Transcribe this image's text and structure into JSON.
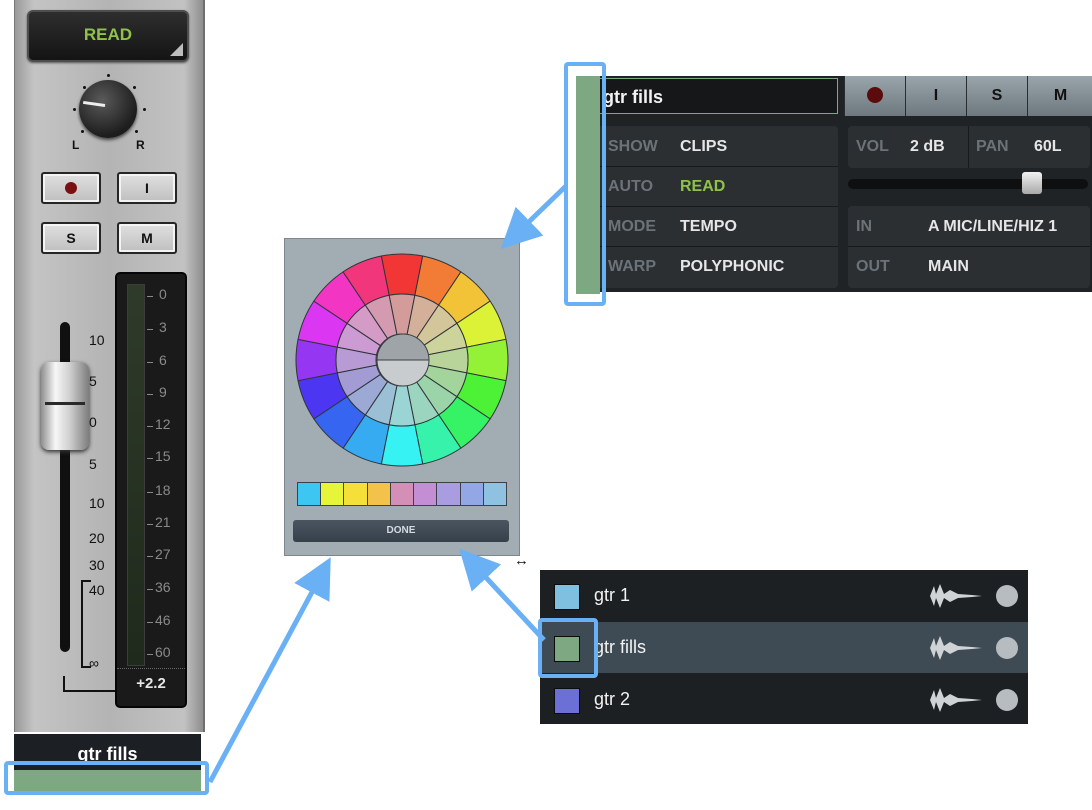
{
  "strip": {
    "automation": "READ",
    "pan_left": "L",
    "pan_right": "R",
    "rec_label": "",
    "input_label": "I",
    "solo_label": "S",
    "mute_label": "M",
    "fader_scale": [
      "10",
      "5",
      "0",
      "5",
      "10",
      "20",
      "30",
      "40",
      "∞"
    ],
    "meter_scale": [
      "0",
      "3",
      "6",
      "9",
      "12",
      "15",
      "18",
      "21",
      "27",
      "36",
      "46",
      "60"
    ],
    "meter_readout": "+2.2",
    "track_name": "gtr fills",
    "track_color": "#7da882"
  },
  "color_picker": {
    "swatches": [
      "#3ec6f2",
      "#e6f53a",
      "#f5e03a",
      "#f2c24a",
      "#d38fb5",
      "#c38ed3",
      "#a99ce0",
      "#93a6e6",
      "#8ec2e0"
    ],
    "done_label": "DONE"
  },
  "track_header": {
    "name": "gtr fills",
    "buttons": [
      "",
      "I",
      "S",
      "M"
    ],
    "show_label": "SHOW",
    "show_value": "CLIPS",
    "auto_label": "AUTO",
    "auto_value": "READ",
    "mode_label": "MODE",
    "mode_value": "TEMPO",
    "warp_label": "WARP",
    "warp_value": "POLYPHONIC",
    "vol_label": "VOL",
    "vol_value": "2 dB",
    "pan_label": "PAN",
    "pan_value": "60L",
    "in_label": "IN",
    "in_value": "A MIC/LINE/HIZ 1",
    "out_label": "OUT",
    "out_value": "MAIN"
  },
  "track_list": [
    {
      "name": "gtr 1",
      "color": "#7fbfe0"
    },
    {
      "name": "gtr fills",
      "color": "#7da882",
      "selected": true
    },
    {
      "name": "gtr 2",
      "color": "#6b6fd6"
    }
  ],
  "colors": {
    "highlight": "#6ab0f5",
    "accent_green": "#8fc24a"
  }
}
